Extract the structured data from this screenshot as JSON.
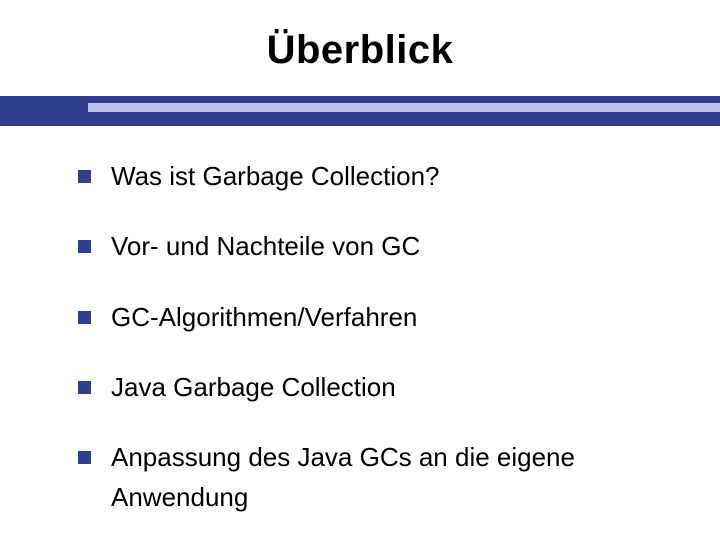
{
  "title": "Überblick",
  "bullets": [
    "Was ist Garbage Collection?",
    "Vor- und Nachteile von GC",
    "GC-Algorithmen/Verfahren",
    "Java Garbage Collection",
    "Anpassung des Java GCs an die eigene Anwendung"
  ]
}
